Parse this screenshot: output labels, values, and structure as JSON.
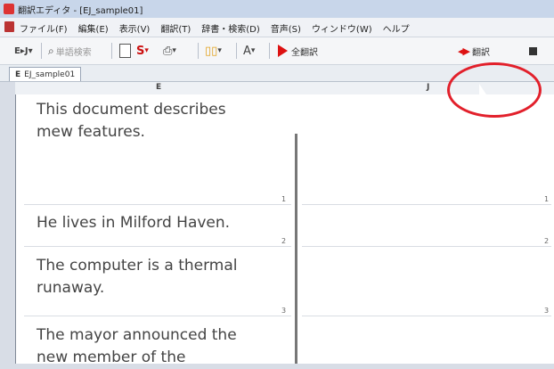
{
  "window": {
    "title": "翻訳エディタ - [EJ_sample01]"
  },
  "menu": {
    "items": [
      "ファイル(F)",
      "編集(E)",
      "表示(V)",
      "翻訳(T)",
      "辞書・検索(D)",
      "音声(S)",
      "ウィンドウ(W)",
      "ヘルプ"
    ]
  },
  "toolbar": {
    "mode": "E▸J",
    "search": "単語検索",
    "translate_all": "全翻訳",
    "translate": "翻訳"
  },
  "tabs": [
    {
      "label": "EJ_sample01",
      "prefix": "E"
    }
  ],
  "columns": {
    "left": "E",
    "right": "J"
  },
  "rows": [
    {
      "lines": [
        "This document describes",
        "mew features."
      ],
      "num": "1"
    },
    {
      "lines": [
        "He lives in Milford Haven."
      ],
      "num": "2"
    },
    {
      "lines": [
        "The computer is a thermal",
        "runaway."
      ],
      "num": "3"
    },
    {
      "lines": [
        "The mayor announced the",
        "new member of the"
      ],
      "num": ""
    }
  ]
}
